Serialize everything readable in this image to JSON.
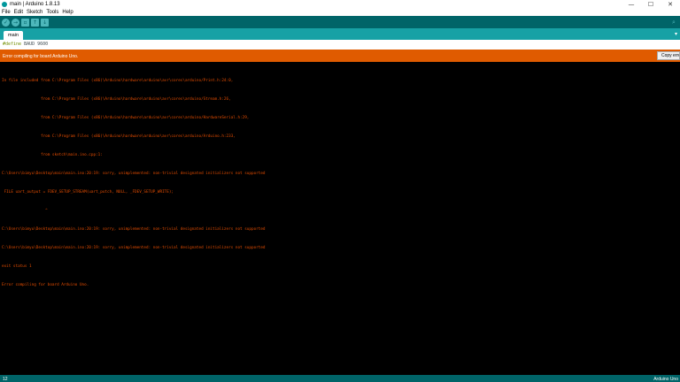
{
  "window": {
    "title": "main | Arduino 1.8.13",
    "minimize": "—",
    "maximize": "☐",
    "close": "✕"
  },
  "menu": [
    "File",
    "Edit",
    "Sketch",
    "Tools",
    "Help"
  ],
  "toolbar": {
    "verify": "✓",
    "upload": "→",
    "new": "▫",
    "open": "↑",
    "save": "↓",
    "serial_monitor": "⌕"
  },
  "tabs": [
    {
      "label": "main"
    }
  ],
  "tab_menu": "▾",
  "editor": {
    "line1_keyword": "#define",
    "line1_rest": " BAUD 9600"
  },
  "status": {
    "message": "Error compiling for board Arduino Uno.",
    "copy_button": "Copy error messages"
  },
  "console": {
    "lines": [
      "In file included from C:\\Program Files (x86)\\Arduino\\hardware\\arduino\\avr\\cores\\arduino/Print.h:24:0,",
      "                 from C:\\Program Files (x86)\\Arduino\\hardware\\arduino\\avr\\cores\\arduino/Stream.h:26,",
      "                 from C:\\Program Files (x86)\\Arduino\\hardware\\arduino\\avr\\cores\\arduino/HardwareSerial.h:29,",
      "                 from C:\\Program Files (x86)\\Arduino\\hardware\\arduino\\avr\\cores\\arduino/Arduino.h:233,",
      "                 from sketch\\main.ino.cpp:1:",
      "C:\\Users\\bimyu\\Desktop\\main\\main.ino:20:19: sorry, unimplemented: non-trivial designated initializers not supported",
      " FILE uart_output = FDEV_SETUP_STREAM(uart_putch, NULL, _FDEV_SETUP_WRITE);",
      "                   ^",
      "C:\\Users\\bimyu\\Desktop\\main\\main.ino:20:19: sorry, unimplemented: non-trivial designated initializers not supported",
      "C:\\Users\\bimyu\\Desktop\\main\\main.ino:20:19: sorry, unimplemented: non-trivial designated initializers not supported",
      "exit status 1",
      "Error compiling for board Arduino Uno."
    ]
  },
  "bottom": {
    "line_number": "12",
    "board": "Arduino Uno"
  }
}
